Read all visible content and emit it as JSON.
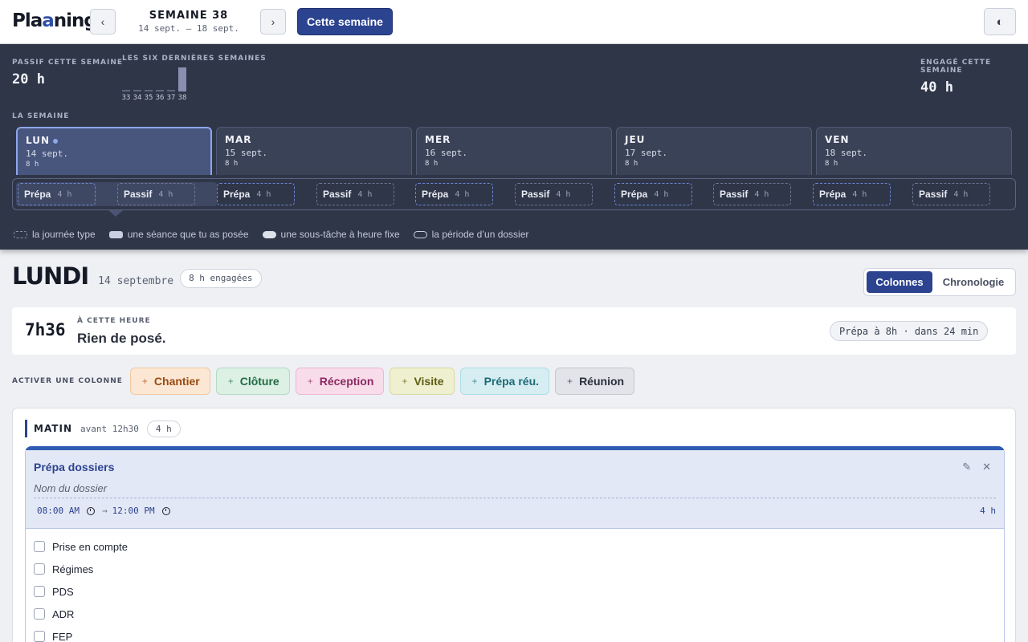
{
  "header": {
    "brand_prefix": "Pla",
    "brand_accent": "a",
    "brand_suffix": "ning",
    "prev_label": "‹",
    "next_label": "›",
    "week_title": "SEMAINE 38",
    "week_range": "14 sept. – 18 sept.",
    "this_week_label": "Cette semaine",
    "theme_icon": "◐"
  },
  "summary": {
    "passive_label": "Passif cette semaine",
    "passive_value": "20 h",
    "history_label": "Les six dernières semaines",
    "history": [
      {
        "week": "33",
        "hours": 0
      },
      {
        "week": "34",
        "hours": 0
      },
      {
        "week": "35",
        "hours": 0
      },
      {
        "week": "36",
        "hours": 0
      },
      {
        "week": "37",
        "hours": 0
      },
      {
        "week": "38",
        "hours": 20
      }
    ],
    "committed_label": "Engagé cette semaine",
    "committed_value": "40 h"
  },
  "week": {
    "label": "La semaine",
    "days": [
      {
        "name": "LUN",
        "date": "14 sept.",
        "hours": "8 h"
      },
      {
        "name": "MAR",
        "date": "15 sept.",
        "hours": "8 h"
      },
      {
        "name": "MER",
        "date": "16 sept.",
        "hours": "8 h"
      },
      {
        "name": "JEU",
        "date": "17 sept.",
        "hours": "8 h"
      },
      {
        "name": "VEN",
        "date": "18 sept.",
        "hours": "8 h"
      }
    ],
    "slots": [
      {
        "label": "Prépa",
        "hours": "4 h",
        "kind": "prepa"
      },
      {
        "label": "Passif",
        "hours": "4 h",
        "kind": "passif"
      },
      {
        "label": "Prépa",
        "hours": "4 h",
        "kind": "prepa"
      },
      {
        "label": "Passif",
        "hours": "4 h",
        "kind": "passif"
      },
      {
        "label": "Prépa",
        "hours": "4 h",
        "kind": "prepa"
      },
      {
        "label": "Passif",
        "hours": "4 h",
        "kind": "passif"
      },
      {
        "label": "Prépa",
        "hours": "4 h",
        "kind": "prepa"
      },
      {
        "label": "Passif",
        "hours": "4 h",
        "kind": "passif"
      },
      {
        "label": "Prépa",
        "hours": "4 h",
        "kind": "prepa"
      },
      {
        "label": "Passif",
        "hours": "4 h",
        "kind": "passif"
      }
    ]
  },
  "legend": {
    "typical_day": "la journée type",
    "session": "une séance que tu as posée",
    "subtask": "une sous-tâche à heure fixe",
    "folder_period": "la période d’un dossier"
  },
  "day": {
    "title": "LUNDI",
    "date": "14 septembre",
    "committed": "8 h engagées",
    "view_columns": "Colonnes",
    "view_timeline": "Chronologie"
  },
  "now": {
    "time": "7h36",
    "label": "À cette heure",
    "text": "Rien de posé.",
    "next": "Prépa à 8h · dans 24 min"
  },
  "activate": {
    "label": "Activer une colonne",
    "chips": [
      {
        "label": "Chantier",
        "fg": "#9a4a10",
        "bg": "#fbe7d3",
        "border": "#f0c9a2"
      },
      {
        "label": "Clôture",
        "fg": "#1f6b43",
        "bg": "#dcf0e3",
        "border": "#b4dcc2"
      },
      {
        "label": "Réception",
        "fg": "#8b2860",
        "bg": "#f8dcea",
        "border": "#ecb8d2"
      },
      {
        "label": "Visite",
        "fg": "#5d5c12",
        "bg": "#eef0cf",
        "border": "#d8dca2"
      },
      {
        "label": "Prépa réu.",
        "fg": "#1d6a78",
        "bg": "#d6eef2",
        "border": "#addde5"
      },
      {
        "label": "Réunion",
        "fg": "#2a2f3c",
        "bg": "#e2e4e9",
        "border": "#c4c8d1"
      }
    ]
  },
  "matin": {
    "title": "MATIN",
    "subtitle": "avant 12h30",
    "hours": "4 h",
    "task": {
      "title": "Prépa dossiers",
      "edit_icon": "✎",
      "close_icon": "✕",
      "folder_placeholder": "Nom du dossier",
      "start": "08:00 AM",
      "arrow": "→",
      "end": "12:00 PM",
      "duration": "4 h",
      "checklist": [
        "Prise en compte",
        "Régimes",
        "PDS",
        "ADR",
        "FEP"
      ]
    }
  }
}
